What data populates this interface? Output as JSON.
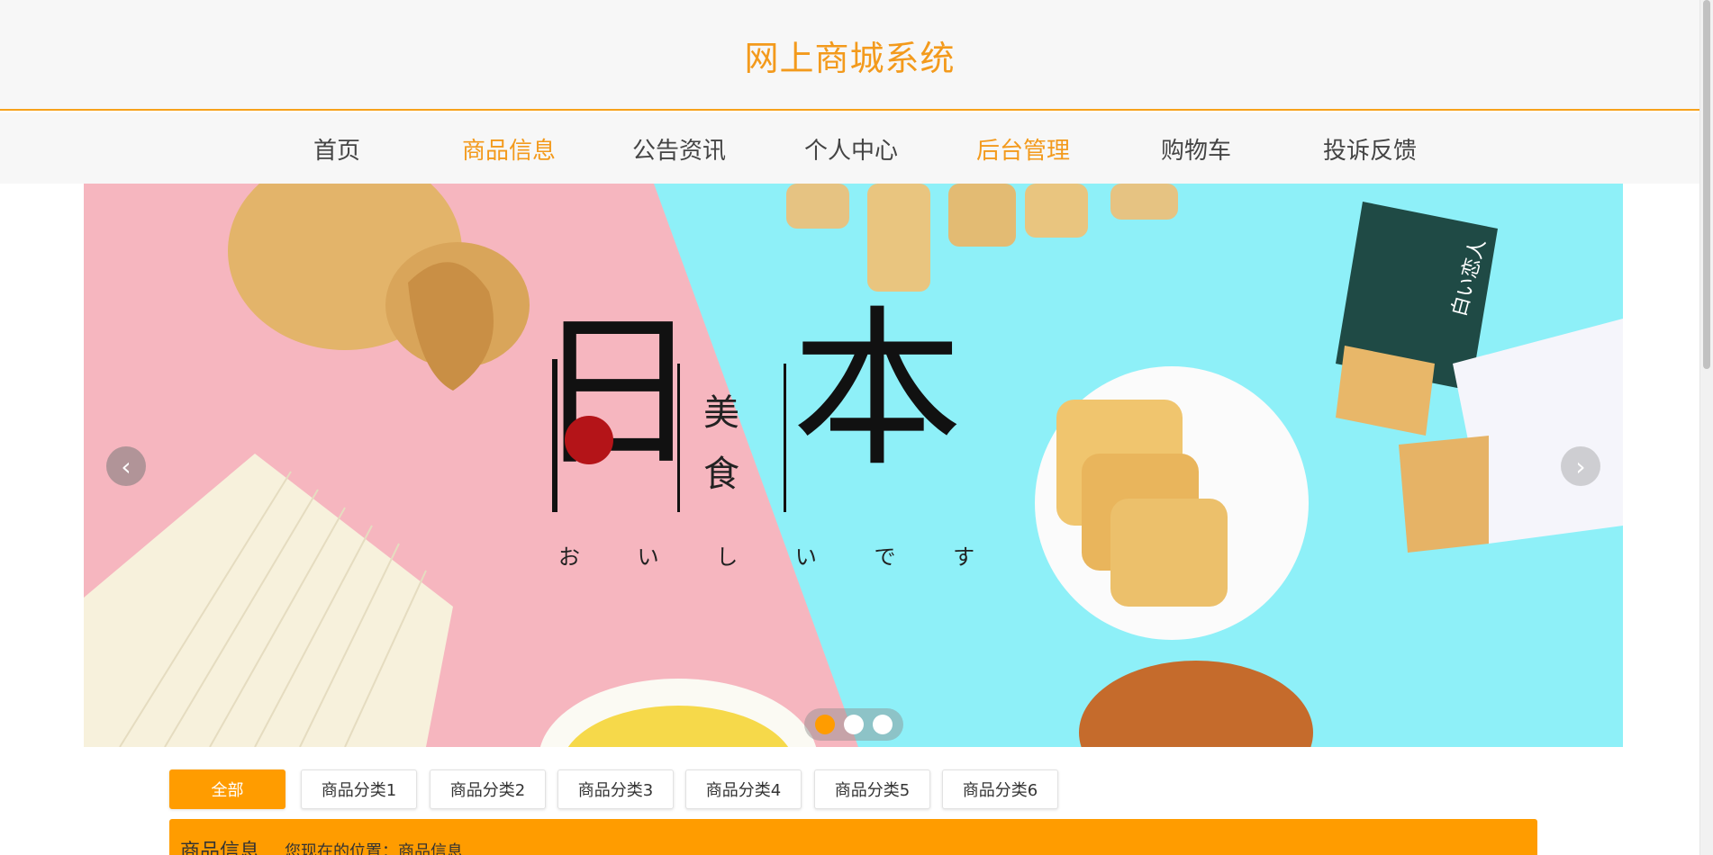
{
  "header": {
    "title": "网上商城系统"
  },
  "nav": {
    "items": [
      {
        "label": "首页",
        "active": false
      },
      {
        "label": "商品信息",
        "active": true
      },
      {
        "label": "公告资讯",
        "active": false
      },
      {
        "label": "个人中心",
        "active": false
      },
      {
        "label": "后台管理",
        "active": true
      },
      {
        "label": "购物车",
        "active": false
      },
      {
        "label": "投诉反馈",
        "active": false
      }
    ]
  },
  "banner": {
    "headline_left": "日",
    "headline_mid_top": "美",
    "headline_mid_bottom": "食",
    "headline_right": "本",
    "subtitle": "お い し い で す",
    "package_text": "白い恋人",
    "slides": 3,
    "active_slide": 1,
    "prev_icon": "chevron-left-icon",
    "next_icon": "chevron-right-icon"
  },
  "categories": {
    "tabs": [
      "全部",
      "商品分类1",
      "商品分类2",
      "商品分类3",
      "商品分类4",
      "商品分类5",
      "商品分类6"
    ],
    "active_index": 0
  },
  "info_bar": {
    "title": "商品信息",
    "breadcrumb": "您现在的位置：商品信息"
  },
  "colors": {
    "accent": "#f39a1c",
    "accent_fill": "#ff9c00",
    "banner_pink": "#f6b6bf",
    "banner_cyan": "#8ef0f8"
  }
}
